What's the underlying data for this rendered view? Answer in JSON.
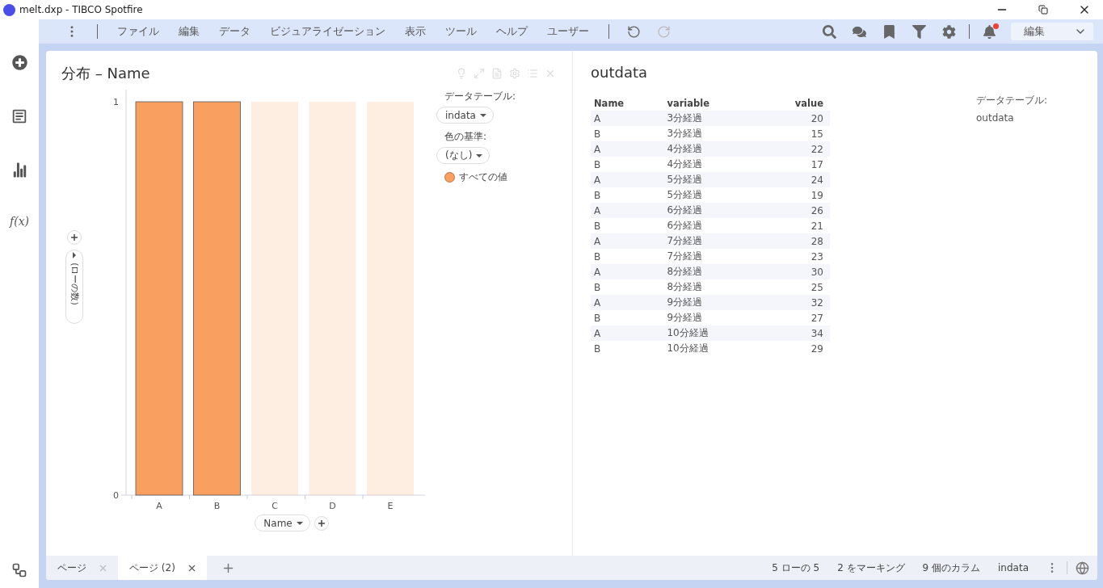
{
  "window": {
    "title": "melt.dxp - TIBCO Spotfire"
  },
  "sidebar": {
    "formula_label": "f(x)"
  },
  "menu": [
    "ファイル",
    "編集",
    "データ",
    "ビジュアライゼーション",
    "表示",
    "ツール",
    "ヘルプ",
    "ユーザー"
  ],
  "toolbar": {
    "notification_unread": true,
    "mode": "編集"
  },
  "visualization": {
    "title": "分布 – Name",
    "y_axis": {
      "label": "(ローの数)"
    },
    "x_axis": {
      "selector": "Name"
    },
    "chart_data": {
      "type": "bar",
      "categories": [
        "A",
        "B",
        "C",
        "D",
        "E"
      ],
      "series": [
        {
          "name": "すべての値",
          "color": "#f9a061",
          "values": [
            1,
            1,
            1,
            1,
            1
          ]
        }
      ],
      "ylim": [
        0,
        1
      ],
      "yticks": [
        0,
        1
      ]
    },
    "marked": [
      true,
      true,
      false,
      false,
      false
    ],
    "legend": {
      "table_label": "データテーブル:",
      "table": "indata",
      "color_label": "色の基準:",
      "color_by": "(なし)"
    }
  },
  "table_view": {
    "title": "outdata",
    "columns": [
      "Name",
      "variable",
      "value"
    ],
    "rows": [
      [
        "A",
        "3分経過",
        "20"
      ],
      [
        "B",
        "3分経過",
        "15"
      ],
      [
        "A",
        "4分経過",
        "22"
      ],
      [
        "B",
        "4分経過",
        "17"
      ],
      [
        "A",
        "5分経過",
        "24"
      ],
      [
        "B",
        "5分経過",
        "19"
      ],
      [
        "A",
        "6分経過",
        "26"
      ],
      [
        "B",
        "6分経過",
        "21"
      ],
      [
        "A",
        "7分経過",
        "28"
      ],
      [
        "B",
        "7分経過",
        "23"
      ],
      [
        "A",
        "8分経過",
        "30"
      ],
      [
        "B",
        "8分経過",
        "25"
      ],
      [
        "A",
        "9分経過",
        "32"
      ],
      [
        "B",
        "9分経過",
        "27"
      ],
      [
        "A",
        "10分経過",
        "34"
      ],
      [
        "B",
        "10分経過",
        "29"
      ]
    ],
    "legend": {
      "table_label": "データテーブル:",
      "table": "outdata"
    }
  },
  "page_tabs": [
    {
      "label": "ページ",
      "selected": false
    },
    {
      "label": "ページ (2)",
      "selected": true
    }
  ],
  "status_bar": [
    "5 ローの 5",
    "2 をマーキング",
    "9 個のカラム",
    "indata"
  ]
}
